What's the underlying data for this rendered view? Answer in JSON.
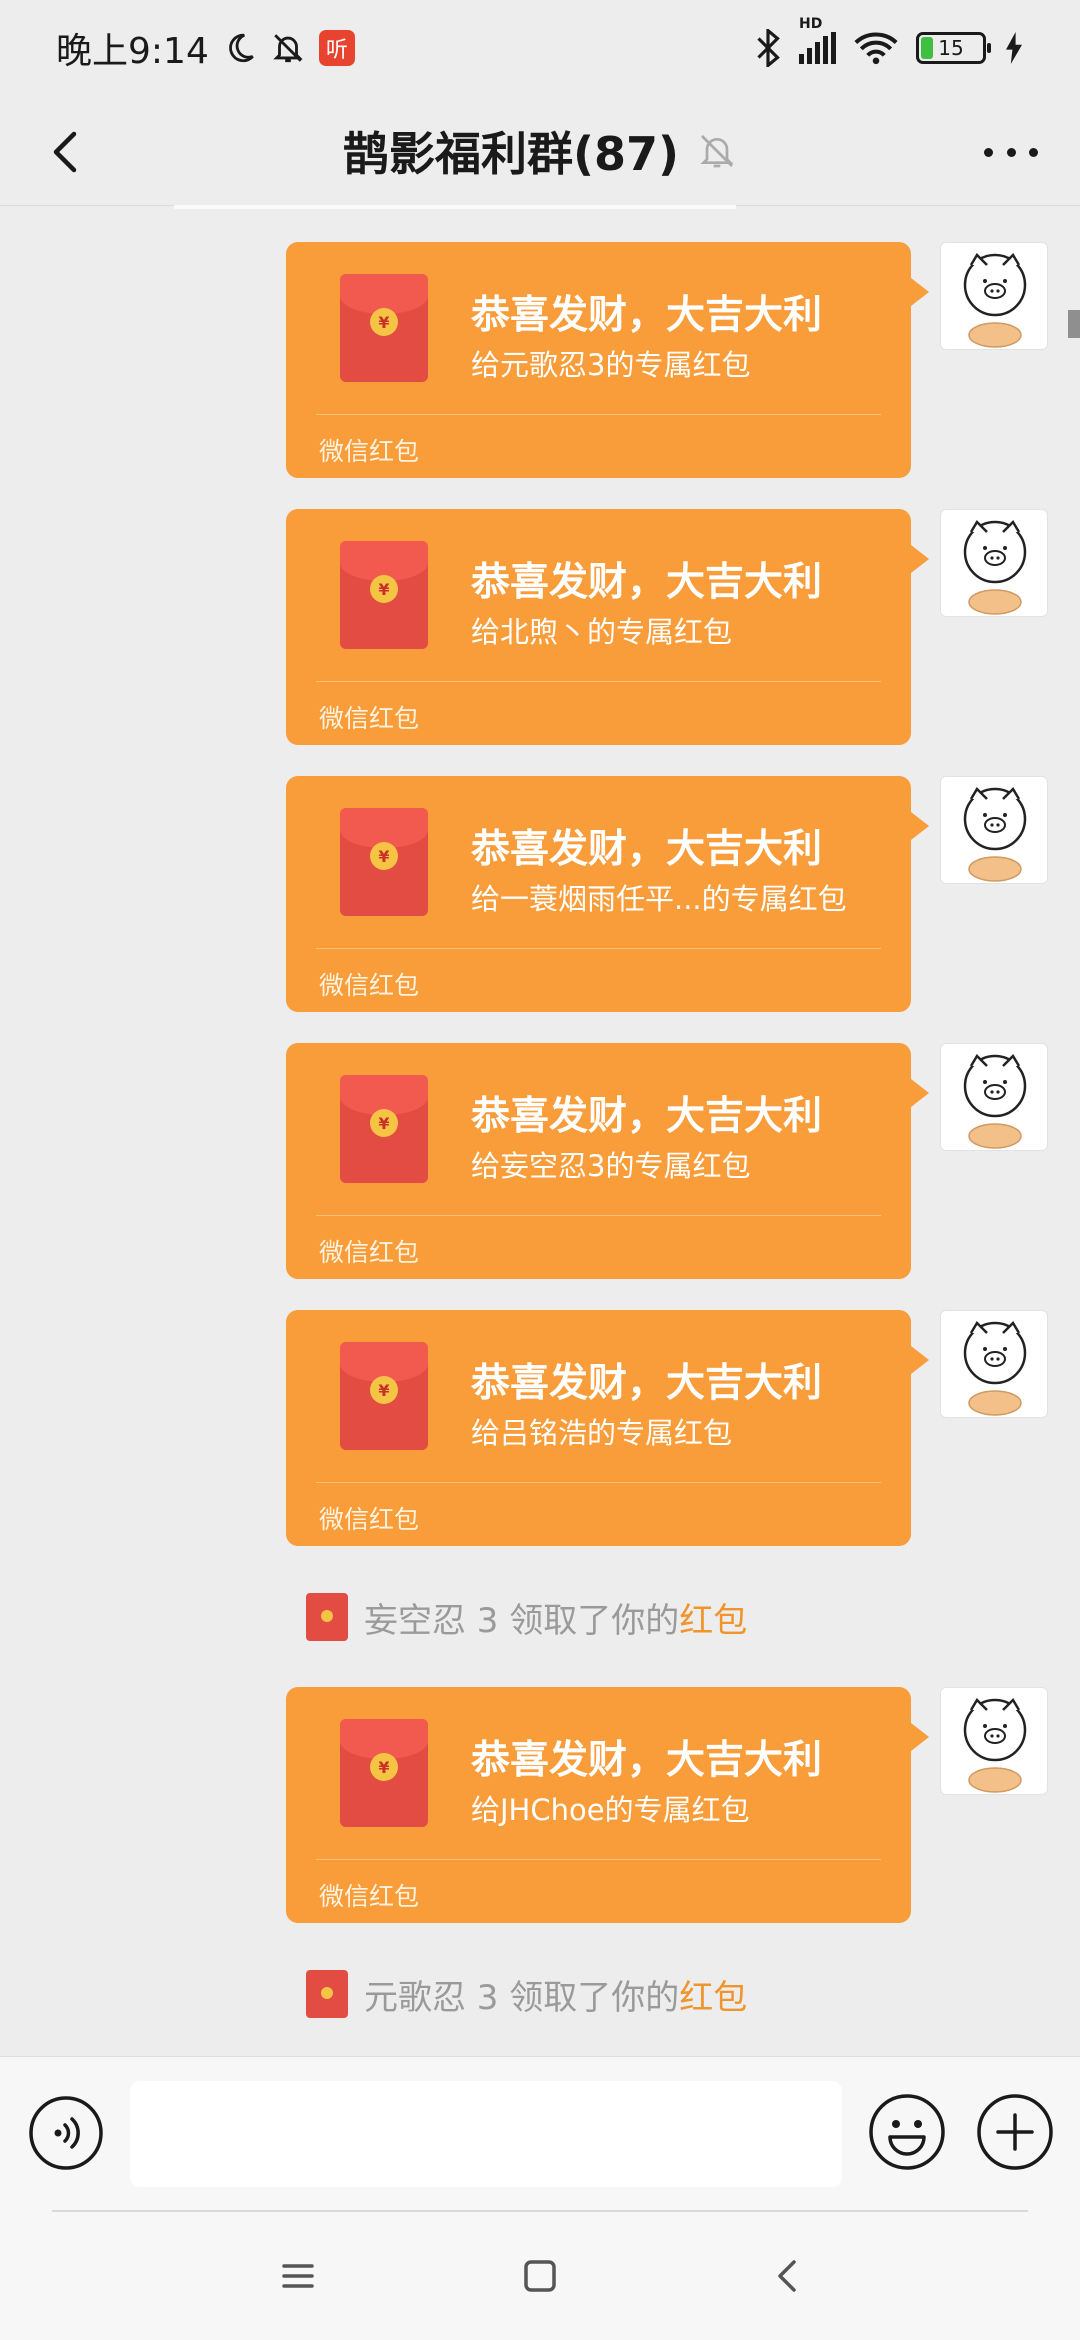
{
  "status_bar": {
    "time": "晚上9:14",
    "app_badge": "听",
    "network": "HD",
    "battery": "15"
  },
  "header": {
    "title": "鹊影福利群(87)",
    "muted": true
  },
  "messages": [
    {
      "type": "red_packet",
      "title": "恭喜发财，大吉大利",
      "subtitle": "给元歌忍3的专属红包",
      "brand": "微信红包"
    },
    {
      "type": "red_packet",
      "title": "恭喜发财，大吉大利",
      "subtitle": "给北煦丶的专属红包",
      "brand": "微信红包"
    },
    {
      "type": "red_packet",
      "title": "恭喜发财，大吉大利",
      "subtitle": "给一蓑烟雨任平...的专属红包",
      "brand": "微信红包"
    },
    {
      "type": "red_packet",
      "title": "恭喜发财，大吉大利",
      "subtitle": "给妄空忍3的专属红包",
      "brand": "微信红包"
    },
    {
      "type": "red_packet",
      "title": "恭喜发财，大吉大利",
      "subtitle": "给吕铭浩的专属红包",
      "brand": "微信红包"
    },
    {
      "type": "system",
      "text": "妄空忍 3 领取了你的",
      "link": "红包"
    },
    {
      "type": "red_packet",
      "title": "恭喜发财，大吉大利",
      "subtitle": "给JHChoe的专属红包",
      "brand": "微信红包"
    },
    {
      "type": "system",
      "text": "元歌忍 3 领取了你的",
      "link": "红包"
    }
  ],
  "input_bar": {
    "value": "",
    "placeholder": ""
  },
  "icons": {
    "back": "chevron-left-icon",
    "more": "more-dots-icon",
    "mute": "bell-off-icon",
    "voice": "voice-icon",
    "emoji": "emoji-icon",
    "plus": "plus-icon"
  },
  "colors": {
    "red_packet": "#f99c3a",
    "packet_icon": "#e24c42",
    "link": "#f0942c",
    "background": "#ededed"
  }
}
